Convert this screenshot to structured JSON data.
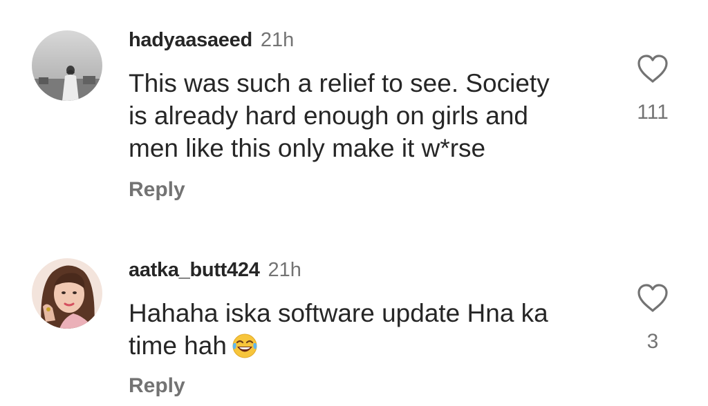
{
  "comments": [
    {
      "username": "hadyaasaeed",
      "time": "21h",
      "text_lines": [
        "This was such a relief to see. Society",
        "is already hard enough on girls and",
        "men like this only make it w*rse"
      ],
      "reply_label": "Reply",
      "likes": "111",
      "avatar_icon": "grayscale-profile-photo"
    },
    {
      "username": "aatka_butt424",
      "time": "21h",
      "text_lines": [
        "Hahaha iska software update Hna ka",
        "time hah"
      ],
      "emoji": "face-with-tears-of-joy",
      "reply_label": "Reply",
      "likes": "3",
      "avatar_icon": "color-profile-photo"
    }
  ],
  "colors": {
    "primary_text": "#262626",
    "secondary_text": "#737373",
    "background": "#ffffff"
  }
}
